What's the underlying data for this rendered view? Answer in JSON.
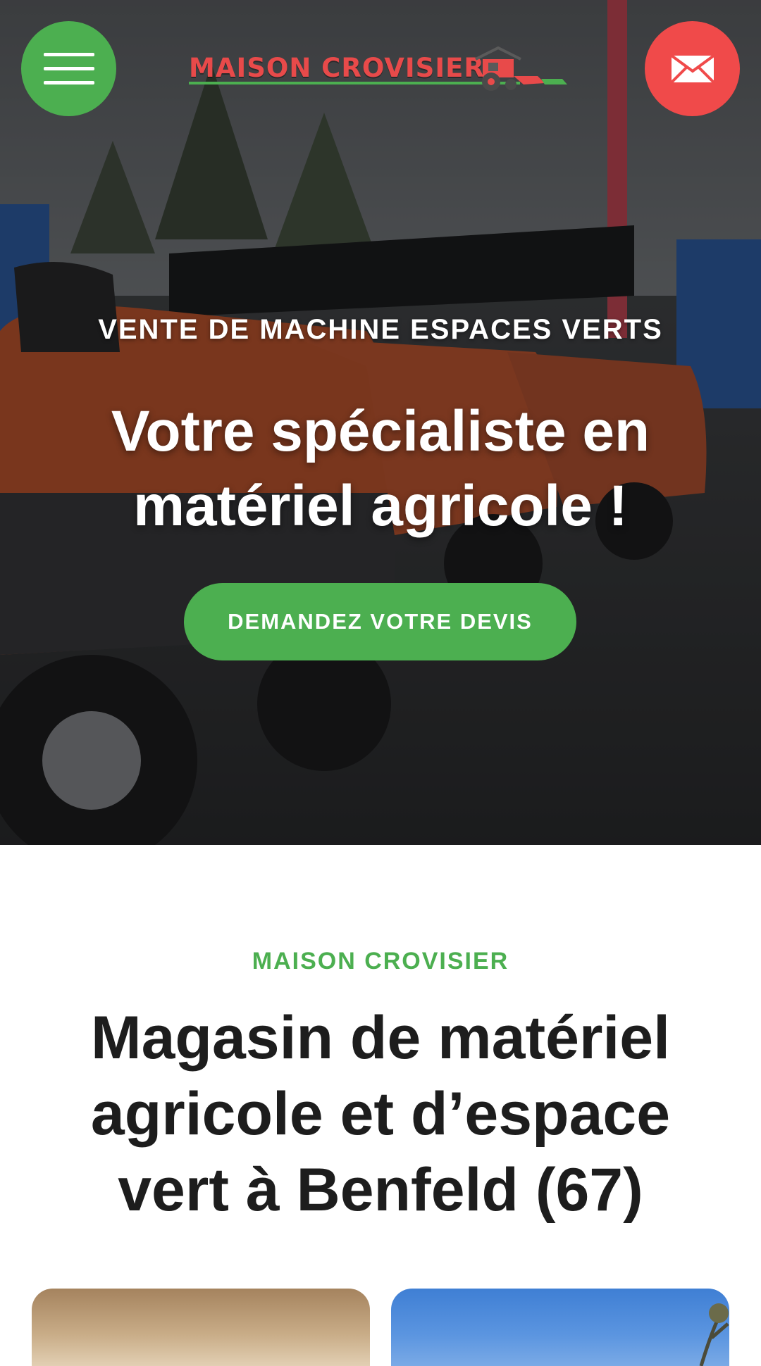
{
  "colors": {
    "accent_green": "#4caf50",
    "accent_red": "#f04a4a",
    "logo_red": "#e84a4a",
    "text_dark": "#1d1d1d"
  },
  "header": {
    "logo_text": "MAISON CROVISIER",
    "menu_icon": "hamburger-menu-icon",
    "contact_icon": "envelope-icon"
  },
  "hero": {
    "kicker": "VENTE DE MACHINE ESPACES VERTS",
    "title": "Votre spécialiste en matériel agricole !",
    "cta_label": "DEMANDEZ VOTRE DEVIS"
  },
  "about": {
    "kicker": "MAISON CROVISIER",
    "title": "Magasin de matériel agricole et d’espace vert à Benfeld (67)"
  },
  "cards": [
    {
      "image": "field-dust-photo"
    },
    {
      "image": "blue-sky-photo"
    }
  ]
}
